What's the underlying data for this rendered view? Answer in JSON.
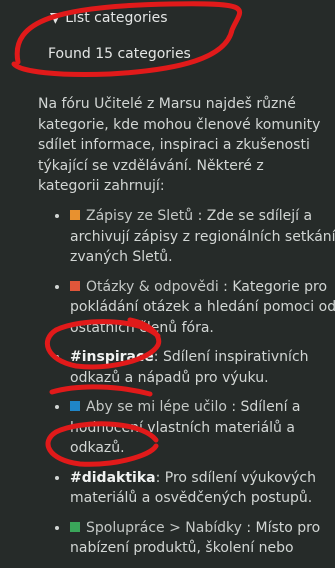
{
  "summary": {
    "toggle_label": "▼ List categories"
  },
  "found_text": "Found 15 categories",
  "intro": "Na fóru Učitelé z Marsu najdeš různé kategorie, kde mohou členové komunity sdílet informace, inspiraci a zkušenosti týkající se vzdělávání. Některé z kategorii zahrnují:",
  "categories": [
    {
      "name": "Zápisy ze Sletů",
      "color": "#e8912f",
      "desc": " : Zde se sdílejí a archivují zápisy z regionálních setkání zvaných Sletů."
    },
    {
      "name": "Otázky & odpovědi",
      "color": "#e0563a",
      "desc": " : Kategorie pro pokládání otázek a hledání pomoci od ostatních členů fóra."
    },
    {
      "name": "#inspirace",
      "color": "",
      "desc": ": Sdílení inspirativních odkazů a nápadů pro výuku."
    },
    {
      "name": "Aby se mi lépe učilo",
      "color": "#1f86c8",
      "desc": " : Sdílení a hodnocení vlastních materiálů a odkazů."
    },
    {
      "name": "#didaktika",
      "color": "",
      "desc": ": Pro sdílení výukových materiálů a osvědčených postupů."
    },
    {
      "name": "Spolupráce > Nabídky",
      "color": "#3aa65a",
      "desc": " : Místo pro nabízení produktů, školení nebo"
    }
  ],
  "colors": {
    "background": "#262b29",
    "annotation_red": "#e11a1a"
  }
}
